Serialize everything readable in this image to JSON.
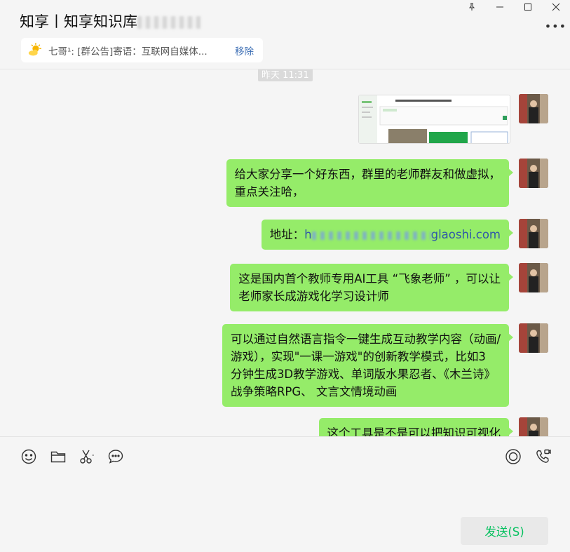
{
  "window": {
    "controls": [
      "pin-icon",
      "minimize-icon",
      "maximize-icon",
      "close-icon"
    ]
  },
  "header": {
    "title": "知享丨知享知识库"
  },
  "notice": {
    "icon": "sun-cloud-icon",
    "text": "七哥¹: [群公告]寄语：互联网自媒体...",
    "action": "移除"
  },
  "chat": {
    "timestamp": "昨天 11:31",
    "messages": [
      {
        "type": "image"
      },
      {
        "type": "text",
        "lines": [
          "给大家分享一个好东西，群里的老师群友和做虚拟，",
          "重点关注哈，"
        ]
      },
      {
        "type": "link",
        "prefix": "地址：",
        "url_start": "h",
        "url_end": "glaoshi.com"
      },
      {
        "type": "text",
        "lines": [
          "这是国内首个教师专用AI工具 “飞象老师” ，可以让",
          "老师家长成游戏化学习设计师"
        ]
      },
      {
        "type": "text",
        "lines": [
          "可以通过自然语言指令一键生成互动教学内容（动画/",
          "游戏），实现\"一课一游戏\"的创新教学模式，比如3",
          "分钟生成3D教学游戏、单词版水果忍者、《木兰诗》",
          "战争策略RPG、 文言文情境动画"
        ]
      },
      {
        "type": "text",
        "lines": [
          "这个工具是不是可以把知识可视化"
        ]
      }
    ]
  },
  "toolbar": {
    "tools": [
      "emoji-icon",
      "folder-icon",
      "scissors-icon",
      "chat-bubble-icon",
      "live-icon",
      "voice-call-icon"
    ],
    "send_label": "发送(S)"
  },
  "colors": {
    "bubble_green": "#95ec69",
    "send_text": "#07c160",
    "link_blue": "#2f58a8",
    "remove_blue": "#3c6eb4"
  }
}
